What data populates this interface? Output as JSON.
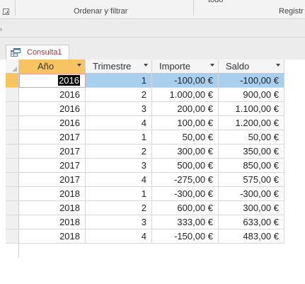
{
  "ribbon": {
    "group_sort_filter": "Ordenar y filtrar",
    "group_records": "Registr",
    "top_partial": "todo"
  },
  "document_tab": {
    "label": "Consulta1"
  },
  "datasheet": {
    "columns": [
      "Año",
      "Trimestre",
      "Importe",
      "Saldo"
    ],
    "active_column_index": 0,
    "current_row_index": 0,
    "rows": [
      [
        "2016",
        "1",
        "-100,00 €",
        "-100,00 €"
      ],
      [
        "2016",
        "2",
        "1.000,00 €",
        "900,00 €"
      ],
      [
        "2016",
        "3",
        "200,00 €",
        "1.100,00 €"
      ],
      [
        "2016",
        "4",
        "100,00 €",
        "1.200,00 €"
      ],
      [
        "2017",
        "1",
        "50,00 €",
        "50,00 €"
      ],
      [
        "2017",
        "2",
        "300,00 €",
        "350,00 €"
      ],
      [
        "2017",
        "3",
        "500,00 €",
        "850,00 €"
      ],
      [
        "2017",
        "4",
        "-275,00 €",
        "575,00 €"
      ],
      [
        "2018",
        "1",
        "-300,00 €",
        "-300,00 €"
      ],
      [
        "2018",
        "2",
        "600,00 €",
        "300,00 €"
      ],
      [
        "2018",
        "3",
        "333,00 €",
        "633,00 €"
      ],
      [
        "2018",
        "4",
        "-150,00 €",
        "483,00 €"
      ]
    ]
  },
  "colors": {
    "active_header": "#f8c462",
    "selected_row": "#a9cfef",
    "tab_label": "#a4373a"
  }
}
